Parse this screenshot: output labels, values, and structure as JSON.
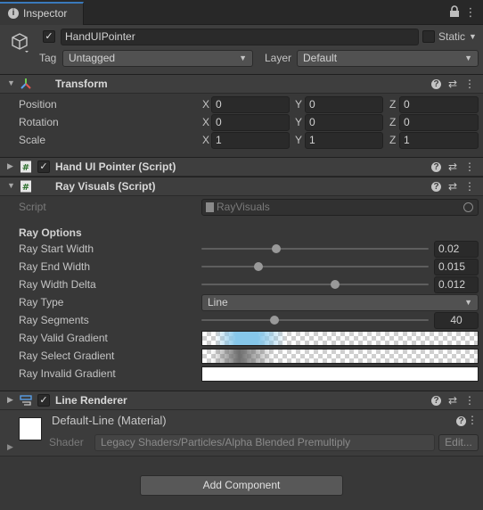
{
  "tab": {
    "title": "Inspector",
    "icons": [
      "info-icon",
      "lock-icon",
      "kebab-menu-icon"
    ]
  },
  "header": {
    "object_name": "HandUIPointer",
    "active": true,
    "static_label": "Static",
    "static_checked": false,
    "tag_label": "Tag",
    "tag_value": "Untagged",
    "layer_label": "Layer",
    "layer_value": "Default"
  },
  "transform": {
    "title": "Transform",
    "rows": [
      {
        "label": "Position",
        "x": "0",
        "y": "0",
        "z": "0"
      },
      {
        "label": "Rotation",
        "x": "0",
        "y": "0",
        "z": "0"
      },
      {
        "label": "Scale",
        "x": "1",
        "y": "1",
        "z": "1"
      }
    ],
    "axis": {
      "x": "X",
      "y": "Y",
      "z": "Z"
    }
  },
  "hand_ui_pointer": {
    "title": "Hand UI Pointer (Script)",
    "enabled": true
  },
  "ray_visuals": {
    "title": "Ray Visuals (Script)",
    "enabled": true,
    "script_label": "Script",
    "script_value": "RayVisuals",
    "section_label": "Ray Options",
    "start_width": {
      "label": "Ray Start Width",
      "value": "0.02",
      "slider_fraction": 0.33
    },
    "end_width": {
      "label": "Ray End Width",
      "value": "0.015",
      "slider_fraction": 0.25
    },
    "width_delta": {
      "label": "Ray Width Delta",
      "value": "0.012",
      "slider_fraction": 0.59
    },
    "ray_type": {
      "label": "Ray Type",
      "value": "Line"
    },
    "segments": {
      "label": "Ray Segments",
      "value": "40",
      "slider_fraction": 0.32
    },
    "valid_gradient": {
      "label": "Ray Valid Gradient",
      "color": "#86c7ea"
    },
    "select_gradient": {
      "label": "Ray Select Gradient",
      "color": "#6e6e6e"
    },
    "invalid_gradient": {
      "label": "Ray Invalid Gradient",
      "color": "#ffffff"
    }
  },
  "line_renderer": {
    "title": "Line Renderer",
    "enabled": true
  },
  "material": {
    "name": "Default-Line (Material)",
    "shader_label": "Shader",
    "shader_value": "Legacy Shaders/Particles/Alpha Blended Premultiply",
    "edit_label": "Edit...",
    "swatch_color": "#ffffff"
  },
  "add_component_label": "Add Component",
  "colors": {
    "accent": "#3a79bb",
    "background": "#383838",
    "header": "#3e3e3e"
  }
}
